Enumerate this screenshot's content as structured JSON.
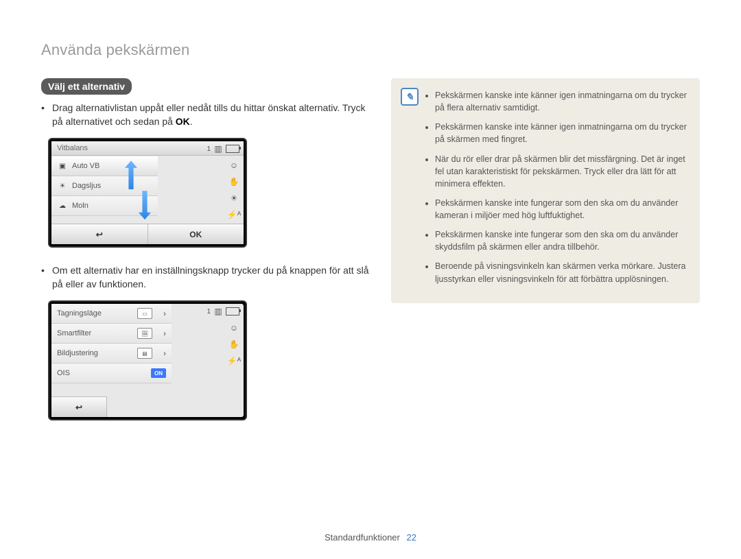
{
  "header": {
    "title": "Använda pekskärmen"
  },
  "section": {
    "heading": "Välj ett alternativ"
  },
  "paragraphs": {
    "drag_instruction": "Drag alternativlistan uppåt eller nedåt tills du hittar önskat alternativ. Tryck på alternativet och sedan på",
    "ok_word": "OK",
    "toggle_instruction": "Om ett alternativ har en inställningsknapp trycker du på knappen för att slå på eller av funktionen."
  },
  "camera1": {
    "title": "Vitbalans",
    "items": [
      {
        "icon": "awb",
        "label": "Auto VB"
      },
      {
        "icon": "sun",
        "label": "Dagsljus"
      },
      {
        "icon": "cloud",
        "label": "Moln"
      }
    ],
    "back_label": "↩",
    "ok_label": "OK",
    "status_count": "1",
    "side_icons": [
      "card",
      "face",
      "ois",
      "wb",
      "flash"
    ]
  },
  "camera2": {
    "items": [
      {
        "label": "Tagningsläge",
        "value_icon": "rect",
        "chev": true
      },
      {
        "label": "Smartfilter",
        "value_icon": "pict",
        "chev": true
      },
      {
        "label": "Bildjustering",
        "value_icon": "bars",
        "chev": true
      },
      {
        "label": "OIS",
        "on": "ON"
      }
    ],
    "back_label": "↩",
    "status_count": "1",
    "side_icons": [
      "card",
      "face",
      "ois",
      "flash"
    ]
  },
  "note": {
    "items": [
      "Pekskärmen kanske inte känner igen inmatningarna om du trycker på flera alternativ samtidigt.",
      "Pekskärmen kanske inte känner igen inmatningarna om du trycker på skärmen med fingret.",
      "När du rör eller drar på skärmen blir det missfärgning. Det är inget fel utan karakteristiskt för pekskärmen. Tryck eller dra lätt för att minimera effekten.",
      "Pekskärmen kanske inte fungerar som den ska om du använder kameran i miljöer med hög luftfuktighet.",
      "Pekskärmen kanske inte fungerar som den ska om du använder skyddsfilm på skärmen eller andra tillbehör.",
      "Beroende på visningsvinkeln kan skärmen verka mörkare. Justera ljusstyrkan eller visningsvinkeln för att förbättra upplösningen."
    ]
  },
  "footer": {
    "section": "Standardfunktioner",
    "page": "22"
  }
}
